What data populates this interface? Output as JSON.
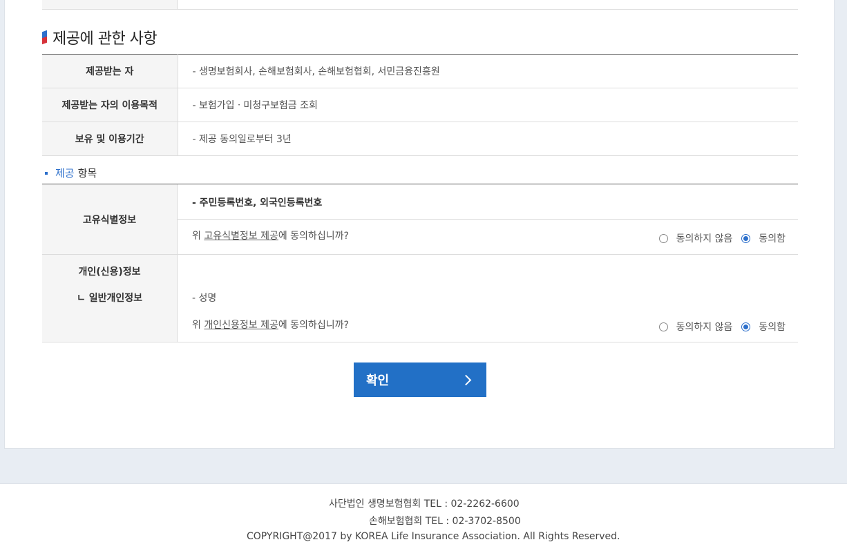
{
  "section": {
    "title": "제공에 관한 사항"
  },
  "provision_table": {
    "rows": [
      {
        "label": "제공받는 자",
        "value": "- 생명보험회사, 손해보험회사, 손해보험협회, 서민금융진흥원"
      },
      {
        "label": "제공받는 자의 이용목적",
        "value": "- 보험가입ㆍ미청구보험금 조회"
      },
      {
        "label": "보유 및 이용기간",
        "value": "- 제공 동의일로부터 3년"
      }
    ]
  },
  "items_title": {
    "highlight": "제공",
    "rest": "항목"
  },
  "items": [
    {
      "label": "고유식별정보",
      "value": "- 주민등록번호, 외국인등록번호",
      "question_prefix": "위 ",
      "question_link": "고유식별정보 제공",
      "question_suffix": "에 동의하십니까?",
      "disagree_label": "동의하지 않음",
      "agree_label": "동의함",
      "selected": "agree"
    },
    {
      "label": "개인(신용)정보",
      "sub_label": "ㄴ 일반개인정보",
      "value": "- 성명",
      "question_prefix": "위 ",
      "question_link": "개인신용정보 제공",
      "question_suffix": "에 동의하십니까?",
      "disagree_label": "동의하지 않음",
      "agree_label": "동의함",
      "selected": "agree"
    }
  ],
  "confirm_button": {
    "label": "확인"
  },
  "footer": {
    "line1": "사단법인 생명보험협회 TEL : 02-2262-6600",
    "line2": "손해보험협회 TEL : 02-3702-8500",
    "line3": "COPYRIGHT@2017 by KOREA Life Insurance Association. All Rights Reserved."
  },
  "colors": {
    "accent": "#2270c6",
    "page_bg": "#e8edf3"
  }
}
